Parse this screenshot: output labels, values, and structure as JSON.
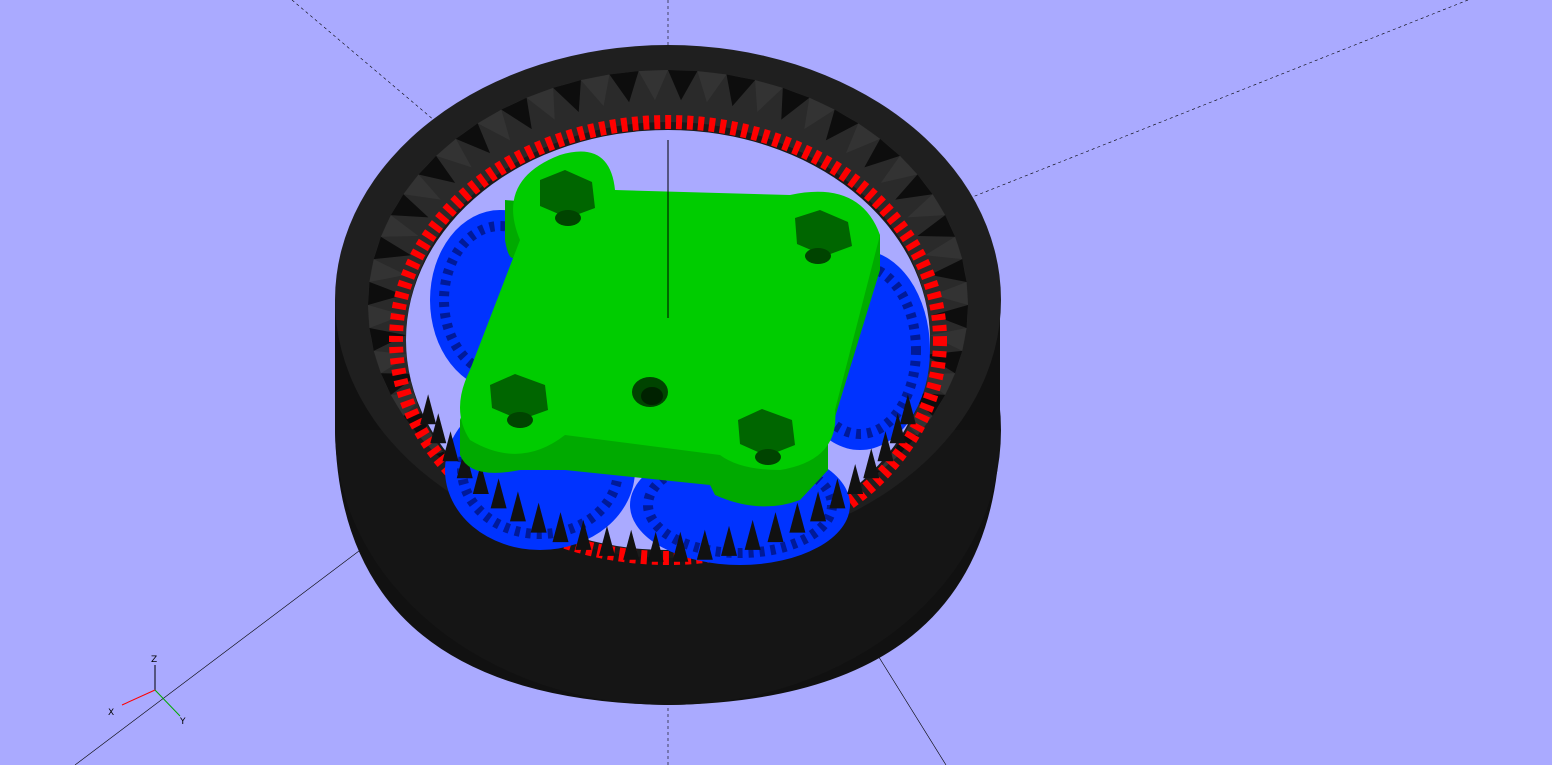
{
  "viewport": {
    "background_color": "#aaaaff",
    "axes": {
      "x_label": "X",
      "y_label": "Y",
      "z_label": "Z",
      "x_color": "#ff0000",
      "y_color": "#00aa00",
      "z_color": "#000000"
    },
    "model": {
      "ring_gear_color": "#1a1a1a",
      "ring_teeth_color": "#ff0000",
      "planet_gears_color": "#0033ff",
      "carrier_plate_color": "#00cc00",
      "carrier_shade_color": "#009900"
    }
  }
}
